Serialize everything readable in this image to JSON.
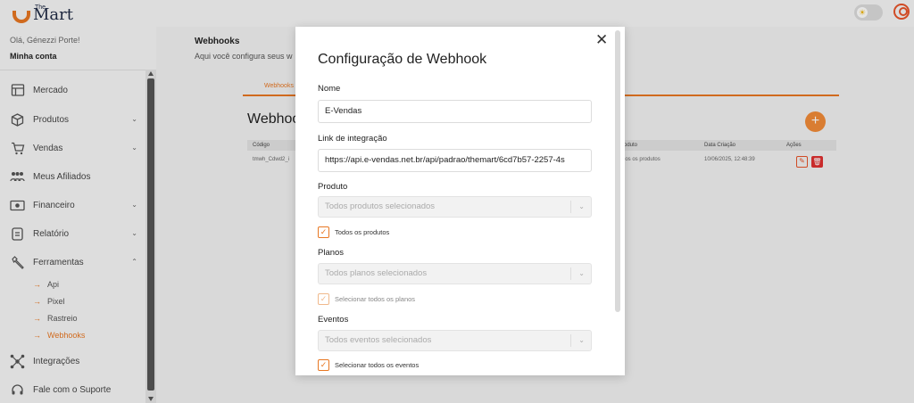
{
  "app": {
    "logo_small": "The",
    "logo_main": "Mart"
  },
  "sidebar": {
    "greeting": "Olá, Génezzi Porte!",
    "account": "Minha conta",
    "items": [
      {
        "label": "Mercado",
        "icon": "store-icon"
      },
      {
        "label": "Produtos",
        "icon": "box-icon"
      },
      {
        "label": "Vendas",
        "icon": "cart-icon"
      },
      {
        "label": "Meus Afiliados",
        "icon": "people-icon"
      },
      {
        "label": "Financeiro",
        "icon": "money-icon"
      },
      {
        "label": "Relatório",
        "icon": "report-icon"
      },
      {
        "label": "Ferramentas",
        "icon": "tools-icon"
      },
      {
        "label": "Integrações",
        "icon": "integrations-icon"
      },
      {
        "label": "Fale com o Suporte",
        "icon": "headset-icon"
      }
    ],
    "sub_items": [
      "Api",
      "Pixel",
      "Rastreio",
      "Webhooks"
    ],
    "active_sub": "Webhooks"
  },
  "main": {
    "title": "Webhooks",
    "subtitle": "Aqui você configura seus w",
    "tab": "Webhooks",
    "section": "Webhoo",
    "add_symbol": "+",
    "headers": {
      "code": "Código",
      "product": "roduto",
      "date": "Data Criação",
      "actions": "Ações"
    },
    "row": {
      "code": "tmwh_Cdwd2_i",
      "product": "dos os produtos",
      "date": "10/06/2025, 12:48:39"
    }
  },
  "modal": {
    "close": "✕",
    "title": "Configuração de Webhook",
    "name_label": "Nome",
    "name_value": "E-Vendas",
    "link_label": "Link de integração",
    "link_value": "https://api.e-vendas.net.br/api/padrao/themart/6cd7b57-2257-4s",
    "product_label": "Produto",
    "product_placeholder": "Todos produtos selecionados",
    "product_check": "Todos os produtos",
    "plans_label": "Planos",
    "plans_placeholder": "Todos planos selecionados",
    "plans_check": "Selecionar todos os planos",
    "events_label": "Eventos",
    "events_placeholder": "Todos eventos selecionados",
    "events_check": "Selecionar todos os eventos"
  },
  "colors": {
    "accent": "#e87722",
    "danger": "#e03030"
  }
}
